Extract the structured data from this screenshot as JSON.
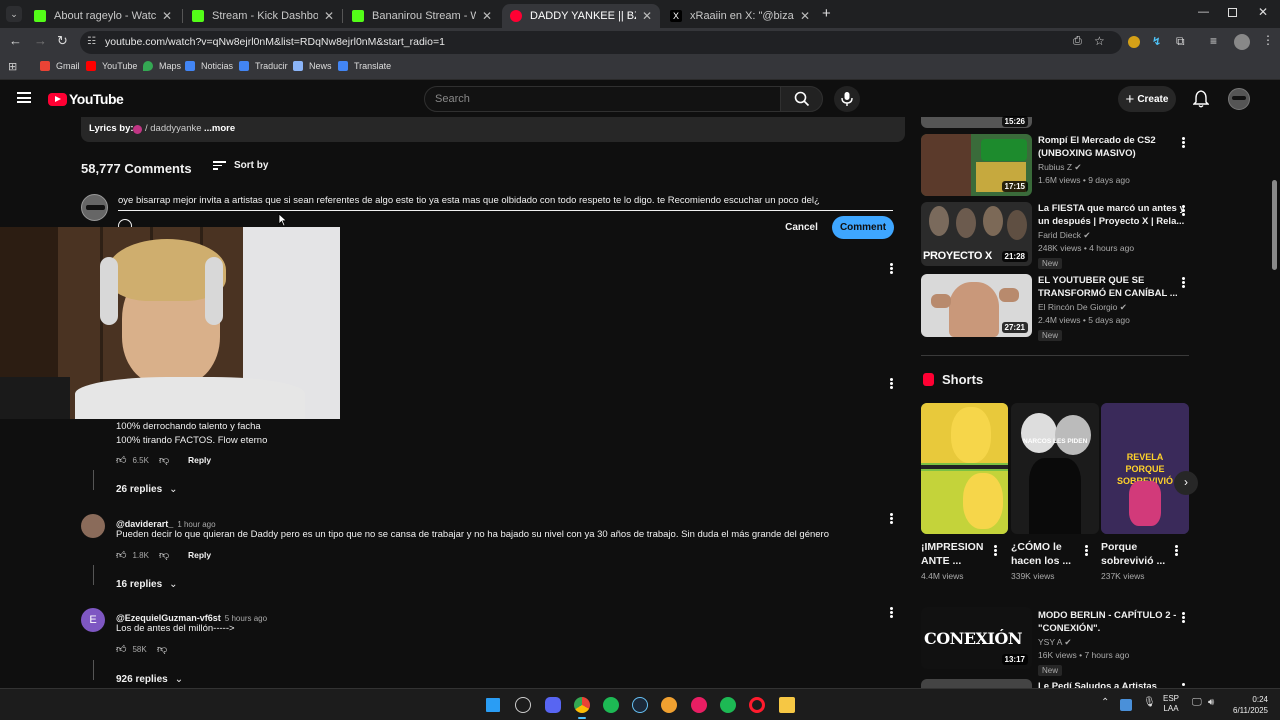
{
  "browser": {
    "tabs": [
      {
        "title": "About rageylo - Watch Live on",
        "active": false
      },
      {
        "title": "Stream - Kick Dashboard",
        "active": false
      },
      {
        "title": "Bananirou Stream - Watch Live",
        "active": false
      },
      {
        "title": "DADDY YANKEE || BZRP Music",
        "active": true
      },
      {
        "title": "xRaaiin en X: \"@bizarrap bingo",
        "active": false
      }
    ],
    "url": "youtube.com/watch?v=qNw8ejrl0nM&list=RDqNw8ejrl0nM&start_radio=1",
    "bookmarks": [
      "Gmail",
      "YouTube",
      "Maps",
      "Noticias",
      "Traducir",
      "News",
      "Translate"
    ]
  },
  "header": {
    "logo": "YouTube",
    "search_placeholder": "Search",
    "create_label": "Create"
  },
  "lyrics": {
    "label": "Lyrics by:",
    "author": "/ daddyyanke",
    "more": "...more"
  },
  "comments_header": {
    "count": "58,777 Comments",
    "sort_label": "Sort by"
  },
  "composer": {
    "text": "oye bisarrap mejor invita a artistas que si sean referentes de algo este tio ya esta mas que olbidado con todo respeto te lo digo. te Recomiendo escuchar un poco del¿",
    "cancel": "Cancel",
    "submit": "Comment"
  },
  "comments": [
    {
      "line1": "100% derrochando talento y facha",
      "line2": "100% tirando FACTOS. Flow eterno",
      "likes": "6.5K",
      "reply": "Reply",
      "replies": "26 replies"
    },
    {
      "author": "@daviderart_",
      "time": "1 hour ago",
      "text": "Pueden decir lo que quieran de Daddy pero es un tipo que no se cansa de trabajar y no ha bajado su nivel con ya 30 años de trabajo. Sin duda el más grande del género",
      "likes": "1.8K",
      "reply": "Reply",
      "replies": "16 replies"
    },
    {
      "author": "@EzequielGuzman-vf6st",
      "time": "5 hours ago",
      "text": "Los de antes del millón----->",
      "avatar_letter": "E",
      "likes": "58K",
      "replies": "926 replies"
    }
  ],
  "sidebar": {
    "top_partial_duration": "15:26",
    "videos": [
      {
        "title1": "Rompí El Mercado de CS2",
        "title2": "(UNBOXING MASIVO)",
        "channel": "Rubius Z",
        "meta": "1.6M views • 9 days ago",
        "duration": "17:15",
        "new": ""
      },
      {
        "title1": "La FIESTA que marcó un antes y",
        "title2": "un después | Proyecto X | Rela...",
        "channel": "Farid Dieck",
        "meta": "248K views • 4 hours ago",
        "duration": "21:28",
        "new": "New",
        "thumb_text": "PROYECTO X"
      },
      {
        "title1": "EL YOUTUBER QUE SE",
        "title2": "TRANSFORMÓ EN CANÍBAL ...",
        "channel": "El Rincón De Giorgio",
        "meta": "2.4M views • 5 days ago",
        "duration": "27:21",
        "new": "New"
      }
    ],
    "shorts_title": "Shorts",
    "shorts": [
      {
        "title1": "¡IMPRESION",
        "title2": "ANTE ...",
        "views": "4.4M views",
        "thumb_text": ""
      },
      {
        "title1": "¿CÓMO le",
        "title2": "hacen los ...",
        "views": "339K views",
        "thumb_text": "NARCOS LES PIDEN"
      },
      {
        "title1": "Porque",
        "title2": "sobrevivió ...",
        "views": "237K views",
        "thumb_text": "REVELA PORQUE SOBREVIVIÓ"
      }
    ],
    "after_shorts": [
      {
        "title1": "MODO BERLIN - CAPÍTULO 2 -",
        "title2": "\"CONEXIÓN\".",
        "channel": "YSY A",
        "meta": "16K views • 7 hours ago",
        "duration": "13:17",
        "new": "New",
        "thumb_text": "CONEXIÓN"
      },
      {
        "title1": "Le Pedí Saludos a Artistas",
        "title2": "",
        "channel": "",
        "meta": "",
        "duration": "",
        "new": ""
      }
    ]
  },
  "taskbar": {
    "lang1": "ESP",
    "lang2": "LAA",
    "time": "0:24",
    "date": "6/11/2025"
  },
  "colors": {
    "accent_blue": "#3ea6ff",
    "yt_red": "#ff0033",
    "bg": "#0f0f0f"
  }
}
